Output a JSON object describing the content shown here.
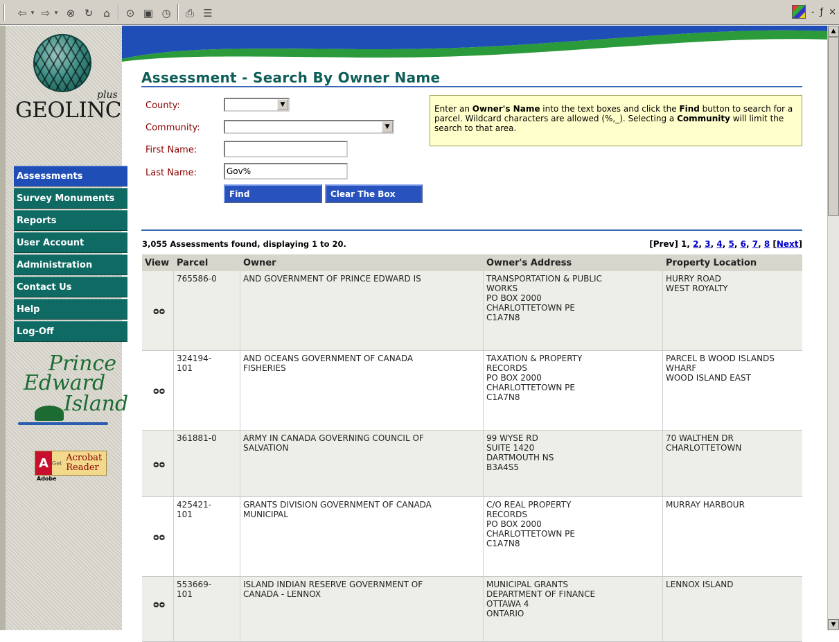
{
  "toolbar": {
    "icons": [
      "back-icon",
      "forward-icon",
      "stop-icon",
      "refresh-icon",
      "home-icon",
      "search-icon",
      "favorites-icon",
      "history-icon",
      "print-icon",
      "edit-icon"
    ],
    "window_controls": [
      "-",
      "ƒ",
      "×"
    ]
  },
  "sidebar": {
    "brand": "GEOLINC",
    "brand_suffix": "plus",
    "nav": [
      {
        "label": "Assessments",
        "active": true
      },
      {
        "label": "Survey Monuments",
        "active": false
      },
      {
        "label": "Reports",
        "active": false
      },
      {
        "label": "User Account",
        "active": false
      },
      {
        "label": "Administration",
        "active": false
      },
      {
        "label": "Contact Us",
        "active": false
      },
      {
        "label": "Help",
        "active": false
      },
      {
        "label": "Log-Off",
        "active": false
      }
    ],
    "pei_logo": [
      "Prince",
      "Edward",
      "Island"
    ],
    "acrobat": {
      "mark": "A",
      "get": "Get",
      "product_1": "Acrobat",
      "product_2": "Reader",
      "brand": "Adobe"
    }
  },
  "main": {
    "title": "Assessment - Search By Owner Name",
    "form": {
      "county_label": "County:",
      "county_value": "",
      "community_label": "Community:",
      "community_value": "",
      "first_name_label": "First Name:",
      "first_name_value": "",
      "last_name_label": "Last Name:",
      "last_name_value": "Gov%",
      "find_label": "Find",
      "clear_label": "Clear The Box"
    },
    "help": {
      "t1": "Enter an ",
      "b1": "Owner's Name",
      "t2": " into the text boxes and click the ",
      "b2": "Find",
      "t3": " button to search for a parcel. Wildcard characters are allowed (%,_). Selecting a ",
      "b3": "Community",
      "t4": " will limit the search to that area."
    },
    "result_count": "3,055 Assessments found, displaying 1 to 20.",
    "pager": {
      "prev": "[Prev]",
      "current": "1",
      "pages": [
        "2",
        "3",
        "4",
        "5",
        "6",
        "7",
        "8"
      ],
      "next": "Next"
    },
    "table": {
      "headers": {
        "view": "View",
        "parcel": "Parcel",
        "owner": "Owner",
        "address": "Owner's Address",
        "location": "Property Location"
      },
      "rows": [
        {
          "parcel": "765586-0",
          "owner": "AND GOVERNMENT OF PRINCE EDWARD IS",
          "address": "TRANSPORTATION & PUBLIC\nWORKS\nPO BOX 2000\nCHARLOTTETOWN PE\nC1A7N8",
          "location": "HURRY ROAD\nWEST ROYALTY"
        },
        {
          "parcel": "324194-\n101",
          "owner": "AND OCEANS GOVERNMENT OF CANADA\nFISHERIES",
          "address": "TAXATION & PROPERTY\nRECORDS\nPO BOX 2000\nCHARLOTTETOWN PE\nC1A7N8",
          "location": "PARCEL B WOOD ISLANDS\nWHARF\nWOOD ISLAND EAST"
        },
        {
          "parcel": "361881-0",
          "owner": "ARMY IN CANADA GOVERNING COUNCIL OF\nSALVATION",
          "address": "99 WYSE RD\nSUITE 1420\nDARTMOUTH NS\nB3A4S5",
          "location": "70 WALTHEN DR\nCHARLOTTETOWN"
        },
        {
          "parcel": "425421-\n101",
          "owner": "GRANTS DIVISION GOVERNMENT OF CANADA\nMUNICIPAL",
          "address": "C/O REAL PROPERTY\nRECORDS\nPO BOX 2000\nCHARLOTTETOWN PE\nC1A7N8",
          "location": "MURRAY HARBOUR"
        },
        {
          "parcel": "553669-\n101",
          "owner": "ISLAND INDIAN RESERVE GOVERNMENT OF\nCANADA - LENNOX",
          "address": "MUNICIPAL GRANTS\nDEPARTMENT OF FINANCE\nOTTAWA 4\nONTARIO",
          "location": "LENNOX ISLAND"
        }
      ]
    }
  },
  "colors": {
    "title": "#0e5e58",
    "nav_bg": "#0e6a63",
    "nav_active": "#1f4fb6",
    "label": "#8b0000",
    "button": "#2853bf",
    "help_bg": "#ffffcc",
    "link": "#0000cc"
  }
}
